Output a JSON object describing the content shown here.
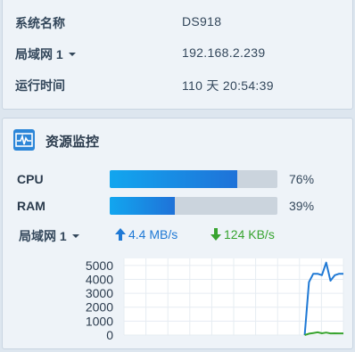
{
  "info": {
    "rows": [
      {
        "label": "系统名称",
        "value": "DS918"
      },
      {
        "label": "局域网 1",
        "value": "192.168.2.239",
        "has_dropdown": true
      },
      {
        "label": "运行时间",
        "value": "110 天 20:54:39"
      }
    ]
  },
  "monitor": {
    "title": "资源监控",
    "icon": "pulse-monitor-icon",
    "cpu": {
      "label": "CPU",
      "percent": 76,
      "percent_text": "76%"
    },
    "ram": {
      "label": "RAM",
      "percent": 39,
      "percent_text": "39%"
    },
    "network": {
      "interface": "局域网 1",
      "upload": "4.4 MB/s",
      "download": "124 KB/s",
      "upload_icon": "arrow-up-icon",
      "download_icon": "arrow-down-icon"
    }
  },
  "colors": {
    "accent": "#1f79d5",
    "download": "#38a430",
    "meter_fill_start": "#12a6ef",
    "meter_fill_end": "#1f72d8",
    "meter_track": "#cbd4dd"
  },
  "chart_data": {
    "type": "line",
    "yticks": [
      "5000",
      "4000",
      "3000",
      "2000",
      "1000",
      "0"
    ],
    "ylim": [
      0,
      5500
    ],
    "grid": true,
    "series": [
      {
        "color": "#1f79d5",
        "values": [
          0,
          0,
          0,
          0,
          0,
          0,
          0,
          0,
          0,
          0,
          0,
          0,
          0,
          0,
          0,
          0,
          0,
          0,
          0,
          0,
          0,
          0,
          0,
          0,
          0,
          0,
          0,
          0,
          0,
          0,
          0,
          0,
          0,
          0,
          0,
          0,
          0,
          0,
          0,
          0,
          0,
          0,
          0,
          3800,
          4400,
          4400,
          4300,
          5200,
          3900,
          4300,
          4400,
          4400
        ]
      },
      {
        "color": "#38a430",
        "values": [
          0,
          0,
          0,
          0,
          0,
          0,
          0,
          0,
          0,
          0,
          0,
          0,
          0,
          0,
          0,
          0,
          0,
          0,
          0,
          0,
          0,
          0,
          0,
          0,
          0,
          0,
          0,
          0,
          0,
          0,
          0,
          0,
          0,
          0,
          0,
          0,
          0,
          0,
          0,
          0,
          0,
          0,
          0,
          100,
          150,
          200,
          130,
          180,
          120,
          130,
          120,
          120
        ]
      }
    ]
  }
}
